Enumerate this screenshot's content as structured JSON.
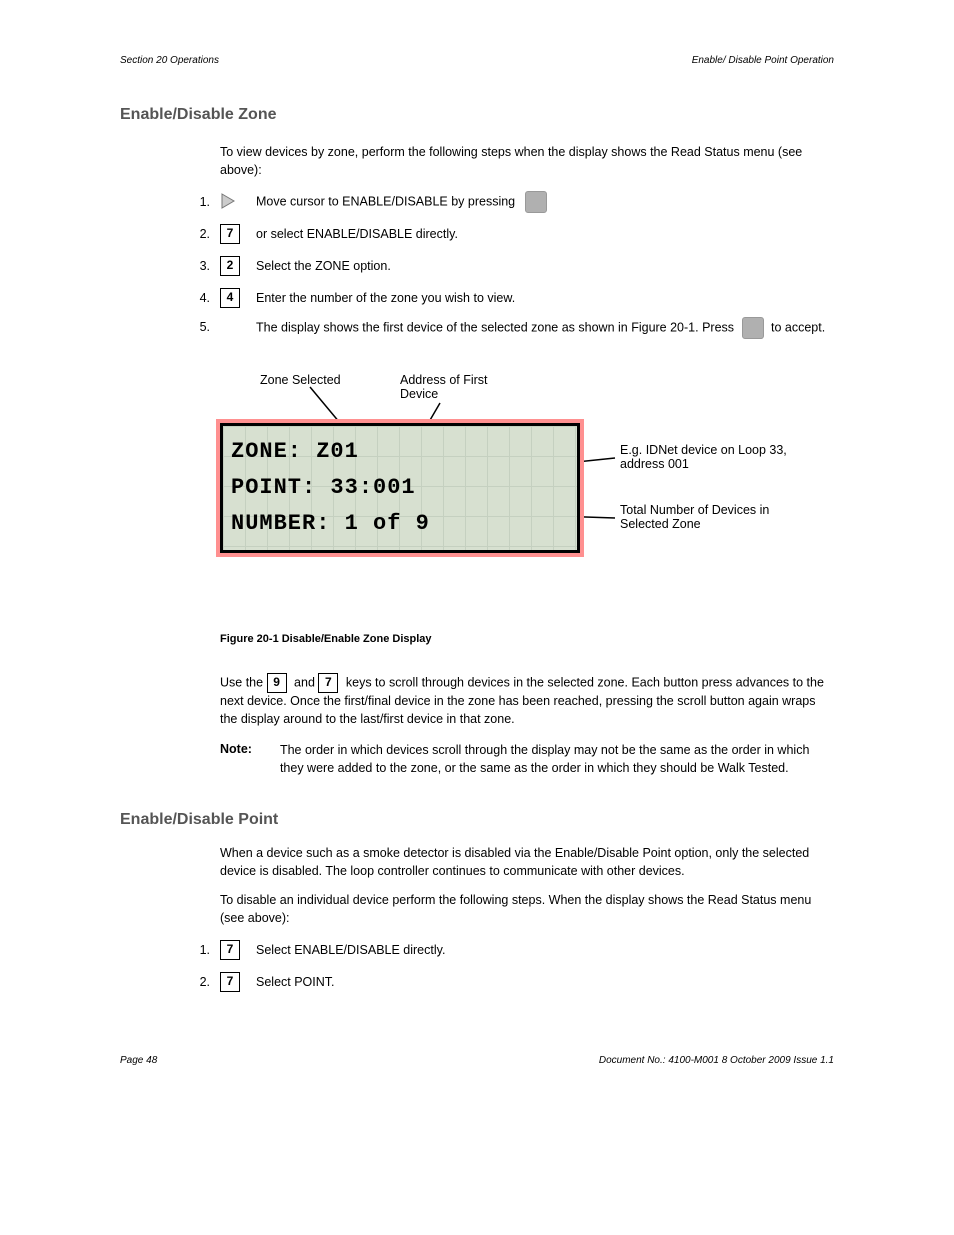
{
  "header": {
    "left": "Section 20 Operations",
    "right": "Enable/ Disable Point Operation"
  },
  "section_title": "Enable/Disable Zone",
  "intro": "To view devices by zone, perform the following steps when the display shows the Read Status menu (see above):",
  "steps": [
    {
      "num": "1.",
      "icon": "triangle-square",
      "text": "Move cursor to ENABLE/DISABLE by pressing"
    },
    {
      "num": "2.",
      "icon": "key-7",
      "text": "or select ENABLE/DISABLE directly."
    },
    {
      "num": "3.",
      "icon": "key-2",
      "text": "Select the ZONE option."
    },
    {
      "num": "4.",
      "icon": "key-4",
      "text": "Enter the number of the zone you wish to view."
    },
    {
      "num": "5.",
      "icon": null,
      "text_parts": [
        "The display shows the first device of the selected zone as shown in Figure 20-1. Press ",
        " to accept."
      ],
      "trailing_icon": "square"
    }
  ],
  "annotations": {
    "tl": "Zone Selected",
    "mid": "Address of First\nDevice",
    "right1": "E.g. IDNet device on Loop 33,\naddress 001",
    "right2": "Total Number of Devices in\nSelected Zone"
  },
  "lcd": {
    "line1": "ZONE: Z01",
    "line2": "POINT: 33:001",
    "line3": "NUMBER: 1 of 9"
  },
  "figure_caption": "Figure 20-1 Disable/Enable Zone Display",
  "keys_text_prefix": "Use the ",
  "keys_text_mid": " and ",
  "keys_text_suffix": " keys to scroll through devices in the selected zone. Each button press advances to the next device. Once the first/final device in the zone has been reached, pressing the scroll button again wraps the display around to the last/first device in that zone.",
  "key_prev": "9",
  "key_next": "7",
  "note_label": "Note:",
  "note_body": "The order in which devices scroll through the display may not be the same as the order in which they were added to the zone, or the same as the order in which they should be Walk Tested.",
  "section2_title": "Enable/Disable Point",
  "section2_intro": "When a device such as a smoke detector is disabled via the Enable/Disable Point option, only the selected device is disabled. The loop controller continues to communicate with other devices.",
  "section2_para2": "To disable an individual device perform the following steps. When the display shows the Read Status menu (see above):",
  "steps2": [
    {
      "num": "1.",
      "icon": "key-7",
      "text": "Select ENABLE/DISABLE directly."
    },
    {
      "num": "2.",
      "icon": "key-7",
      "text": "Select POINT."
    }
  ],
  "footer": {
    "left": "Page 48",
    "right": "Document No.: 4100-M001 8 October 2009 Issue 1.1"
  }
}
